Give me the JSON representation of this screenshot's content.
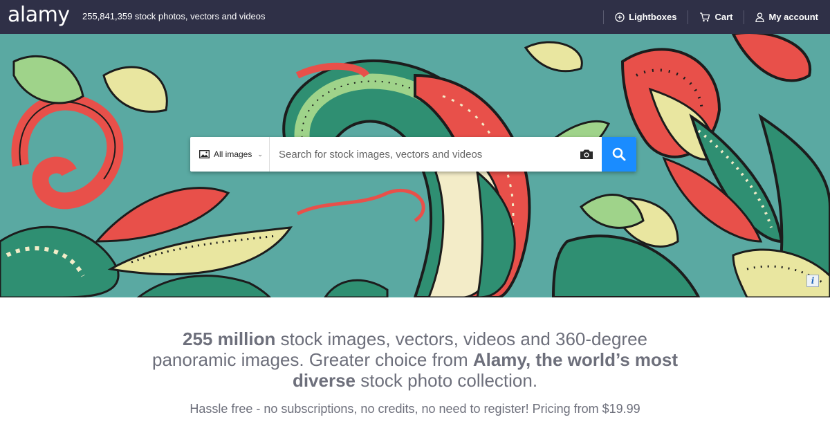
{
  "header": {
    "logo": "alamy",
    "tagline": "255,841,359 stock photos, vectors and videos",
    "nav": [
      {
        "label": "Lightboxes",
        "icon": "plus-circle-icon"
      },
      {
        "label": "Cart",
        "icon": "cart-icon"
      },
      {
        "label": "My account",
        "icon": "user-icon"
      }
    ]
  },
  "search": {
    "scope_label": "All images",
    "placeholder": "Search for stock images, vectors and videos",
    "scope_icon": "image-icon",
    "camera_icon": "camera-icon",
    "submit_icon": "search-icon"
  },
  "hero": {
    "info_badge": "i"
  },
  "content": {
    "headline": {
      "part1_bold": "255 million",
      "part2": " stock images, vectors, videos and 360-degree panoramic images. Greater choice from ",
      "part3_bold": "Alamy, the world’s most diverse",
      "part4": " stock photo collection."
    },
    "subline": "Hassle free - no subscriptions, no credits, no need to register! Pricing from $19.99"
  },
  "colors": {
    "header_bg": "#2f3047",
    "hero_bg": "#5aa9a2",
    "search_button": "#1a8cff",
    "text_gray": "#6d6f7b"
  }
}
